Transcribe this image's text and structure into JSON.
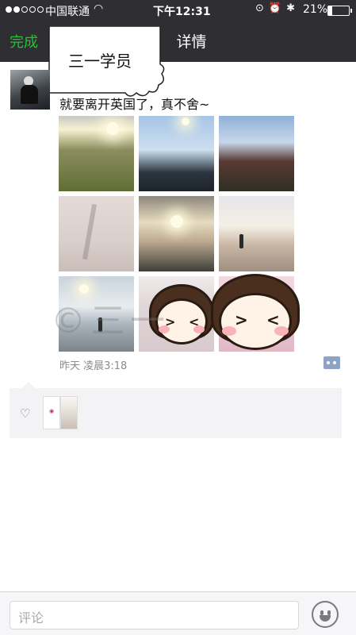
{
  "status_bar": {
    "carrier": "中国联通",
    "time": "下午12:31",
    "battery": "21%",
    "battery_level": 0.21
  },
  "nav": {
    "back_label": "完成",
    "title": "详情"
  },
  "overlay": {
    "bubble_text": "三一学员",
    "watermark": "©三一"
  },
  "post": {
    "text": "就要离开英国了，真不舍~",
    "timestamp": "昨天 凌晨3:18",
    "photo_count": 9
  },
  "likes": {
    "likers": [
      "triplet",
      "portrait"
    ]
  },
  "comment_bar": {
    "placeholder": "评论"
  },
  "colors": {
    "nav_bg": "#2e2e33",
    "accent_green": "#24c331",
    "link_blue": "#6b7c9c"
  }
}
